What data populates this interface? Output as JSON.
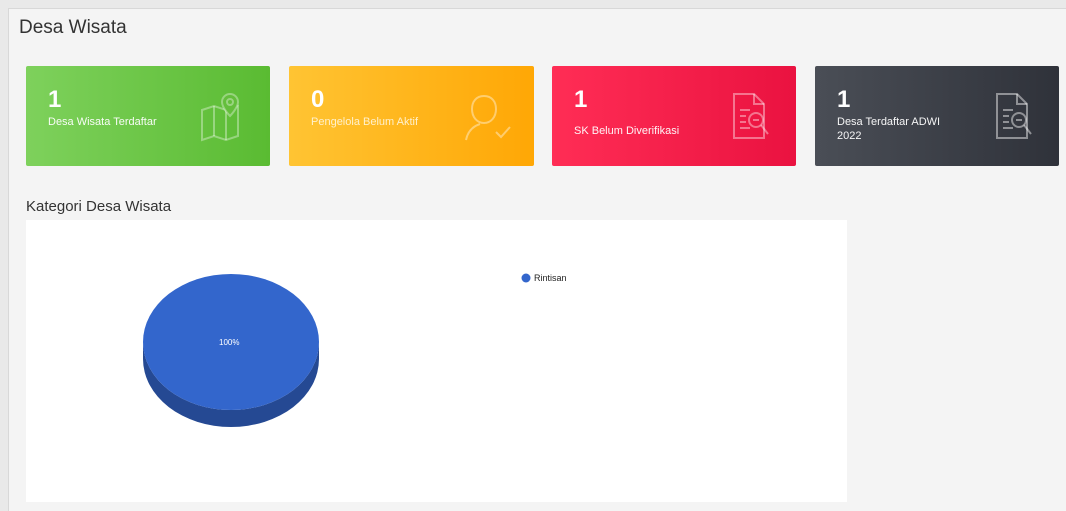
{
  "page": {
    "title": "Desa Wisata"
  },
  "cards": [
    {
      "value": "1",
      "label": "Desa Wisata Terdaftar",
      "icon": "map-pin-icon",
      "color": "#6cc646"
    },
    {
      "value": "0",
      "label": "Pengelola Belum Aktif",
      "icon": "user-check-icon",
      "color": "#ffb31a"
    },
    {
      "value": "1",
      "label": "SK Belum Diverifikasi",
      "icon": "document-search-icon",
      "color": "#f51c4a"
    },
    {
      "value": "1",
      "label": "Desa Terdaftar ADWI 2022",
      "icon": "document-search-icon",
      "color": "#3a3d45"
    }
  ],
  "section": {
    "title": "Kategori Desa Wisata"
  },
  "chart_data": {
    "type": "pie",
    "three_d": true,
    "categories": [
      "Rintisan"
    ],
    "values": [
      1
    ],
    "slice_labels": [
      "100%"
    ],
    "colors": [
      "#3366cc"
    ],
    "legend_position": "top-right"
  }
}
